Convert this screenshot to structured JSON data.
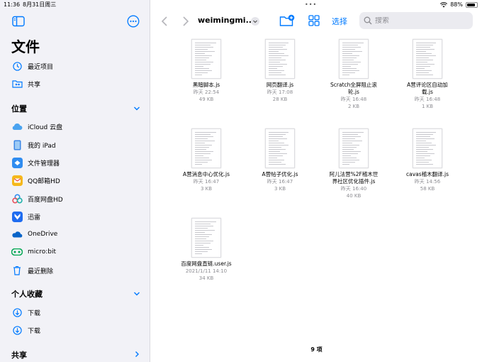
{
  "status": {
    "time": "11:36",
    "date": "8月31日周三",
    "battery": "88%",
    "battery_level": 0.88
  },
  "sidebar": {
    "title": "文件",
    "top_items": [
      {
        "label": "最近项目",
        "icon": "clock-icon"
      },
      {
        "label": "共享",
        "icon": "shared-folder-icon"
      }
    ],
    "locations_header": "位置",
    "locations": [
      {
        "label": "iCloud 云盘",
        "icon": "icloud-icon"
      },
      {
        "label": "我的 iPad",
        "icon": "ipad-icon"
      },
      {
        "label": "文件管理器",
        "icon": "file-manager-icon"
      },
      {
        "label": "QQ邮箱HD",
        "icon": "qq-mail-icon"
      },
      {
        "label": "百度网盘HD",
        "icon": "baidu-netdisk-icon"
      },
      {
        "label": "迅雷",
        "icon": "xunlei-icon"
      },
      {
        "label": "OneDrive",
        "icon": "onedrive-icon"
      },
      {
        "label": "micro:bit",
        "icon": "microbit-icon"
      },
      {
        "label": "最近删除",
        "icon": "trash-icon"
      }
    ],
    "favorites_header": "个人收藏",
    "favorites": [
      {
        "label": "下载",
        "icon": "download-icon"
      },
      {
        "label": "下载",
        "icon": "download-icon"
      }
    ],
    "shared_header": "共享"
  },
  "toolbar": {
    "folder_title": "weimingmi...",
    "select_label": "选择",
    "search_placeholder": "搜索"
  },
  "files": [
    {
      "name": [
        "黑暗脚本.js"
      ],
      "date": "昨天 22:54",
      "size": "49 KB"
    },
    {
      "name": [
        "网页翻译.js"
      ],
      "date": "昨天 17:08",
      "size": "28 KB"
    },
    {
      "name": [
        "Scratch全屏阻止滚",
        "轮.js"
      ],
      "date": "昨天 16:48",
      "size": "2 KB"
    },
    {
      "name": [
        "A营评论区自动加",
        "载.js"
      ],
      "date": "昨天 16:48",
      "size": "1 KB"
    },
    {
      "name": [
        "A营消息中心优化.js"
      ],
      "date": "昨天 16:47",
      "size": "3 KB"
    },
    {
      "name": [
        "A营帖子优化.js"
      ],
      "date": "昨天 16:47",
      "size": "3 KB"
    },
    {
      "name": [
        "阿儿法营%2F稽木世",
        "界社区优化插件.js"
      ],
      "date": "昨天 16:40",
      "size": "40 KB"
    },
    {
      "name": [
        "cavas稽木翻译.js"
      ],
      "date": "昨天 14:56",
      "size": "58 KB"
    },
    {
      "name": [
        "百度网盘直链.user.js"
      ],
      "date": "2021/1/11 14:10",
      "size": "34 KB"
    }
  ],
  "item_count": "9 项",
  "colors": {
    "accent": "#007aff",
    "secondary_text": "#8e8e93",
    "sidebar_bg": "#f2f2f7"
  }
}
